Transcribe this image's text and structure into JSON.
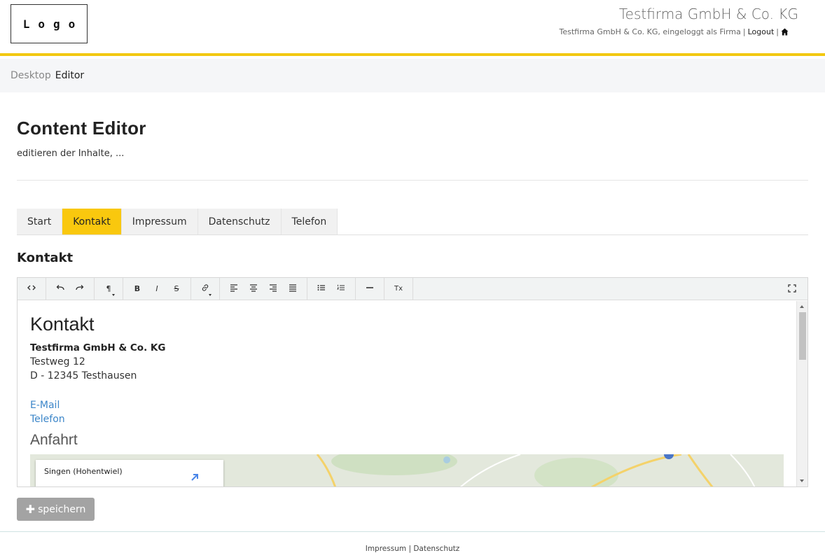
{
  "header": {
    "logo_text": "Logo",
    "company_title": "Testfirma GmbH & Co. KG",
    "user_status": "Testfirma GmbH & Co. KG, eingeloggt als Firma",
    "separator": "|",
    "logout_label": "Logout"
  },
  "breadcrumb": {
    "items": [
      "Desktop",
      "Editor"
    ]
  },
  "page": {
    "title": "Content Editor",
    "subtitle": "editieren der Inhalte, ..."
  },
  "tabs": [
    {
      "label": "Start",
      "active": false
    },
    {
      "label": "Kontakt",
      "active": true
    },
    {
      "label": "Impressum",
      "active": false
    },
    {
      "label": "Datenschutz",
      "active": false
    },
    {
      "label": "Telefon",
      "active": false
    }
  ],
  "section_title": "Kontakt",
  "toolbar": {
    "bold": "B",
    "italic": "I",
    "strike": "S",
    "paragraph": "¶",
    "clear_format": "Tx"
  },
  "content": {
    "heading": "Kontakt",
    "company": "Testfirma GmbH & Co. KG",
    "street": "Testweg 12",
    "city": "D - 12345 Testhausen",
    "email_link": "E-Mail",
    "phone_link": "Telefon",
    "directions_heading": "Anfahrt",
    "map_place": "Singen (Hohentwiel)"
  },
  "save_button": {
    "label": "speichern"
  },
  "footer": {
    "impressum": "Impressum",
    "separator": "|",
    "datenschutz": "Datenschutz"
  },
  "colors": {
    "accent": "#f2c811",
    "active_tab": "#f9c80e",
    "link": "#3c86c9",
    "save_button": "#a3a3a3"
  }
}
